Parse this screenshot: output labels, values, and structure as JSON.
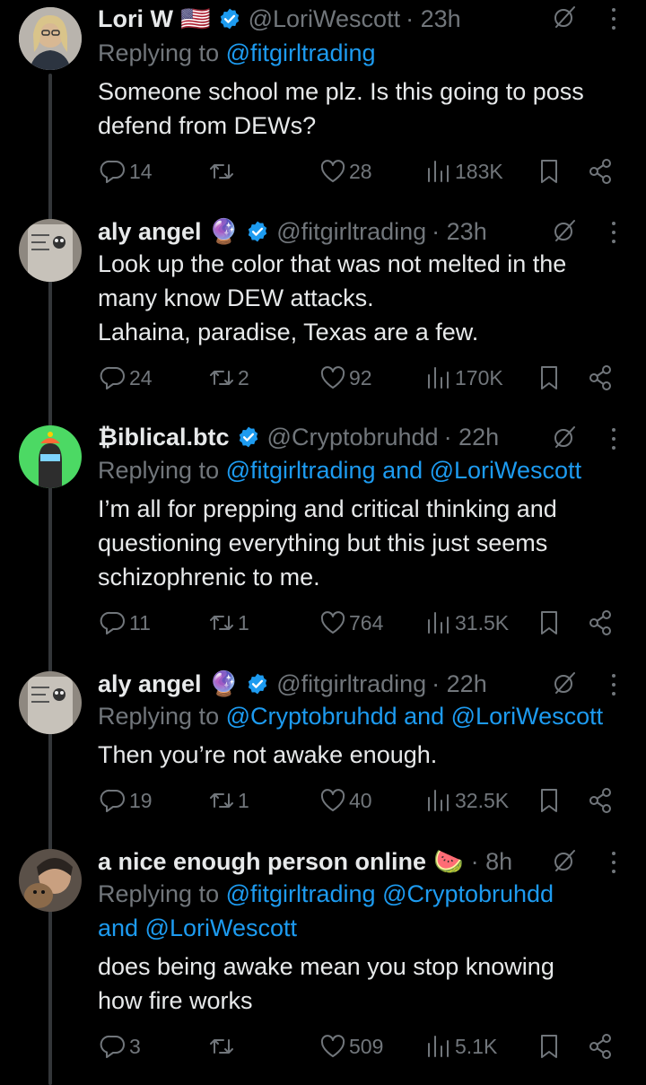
{
  "tweets": [
    {
      "name": "Lori W",
      "flag": "🇺🇸",
      "handle": "@LoriWescott",
      "time": "· 23h",
      "reply_prefix": "Replying to ",
      "reply_lines": [
        [
          "@fitgirltrading"
        ]
      ],
      "text_lines": [
        "Someone school me plz. Is this going to poss",
        "defend from DEWs?"
      ],
      "replies": "14",
      "retweets": "",
      "likes": "28",
      "views": "183K"
    },
    {
      "name": "aly angel",
      "emoji": "🔮",
      "handle": "@fitgirltrading",
      "time": "· 23h",
      "text_lines": [
        "Look up the color that was not melted in the",
        "many know DEW attacks.",
        "Lahaina, paradise, Texas are a few."
      ],
      "replies": "24",
      "retweets": "2",
      "likes": "92",
      "views": "170K"
    },
    {
      "name": "₿iblical.btc",
      "handle": "@Cryptobruhdd",
      "time": "· 22h",
      "reply_prefix": "Replying to ",
      "reply_line": "@fitgirltrading and @LoriWescott",
      "text_lines": [
        "I’m all for prepping and critical thinking and",
        "questioning everything but this just seems",
        "schizophrenic to me."
      ],
      "replies": "11",
      "retweets": "1",
      "likes": "764",
      "views": "31.5K"
    },
    {
      "name": "aly angel",
      "emoji": "🔮",
      "handle": "@fitgirltrading",
      "time": "· 22h",
      "reply_prefix": "Replying to ",
      "reply_line": "@Cryptobruhdd and @LoriWescott",
      "text_lines": [
        "Then you’re not awake enough."
      ],
      "replies": "19",
      "retweets": "1",
      "likes": "40",
      "views": "32.5K"
    },
    {
      "name": "a nice enough person online",
      "emoji": "🍉",
      "time": "· 8h",
      "reply_prefix": "Replying to ",
      "reply_line1": "@fitgirltrading @Cryptobruhdd",
      "reply_line2": "and @LoriWescott",
      "text_lines": [
        "does being awake mean you stop knowing",
        "how fire works"
      ],
      "replies": "3",
      "retweets": "",
      "likes": "509",
      "views": "5.1K"
    }
  ],
  "colors": {
    "accent": "#1d9bf0",
    "muted": "#71767b",
    "text": "#e7e9ea",
    "background": "#000000"
  },
  "icons": [
    "reply-icon",
    "retweet-icon",
    "like-icon",
    "views-icon",
    "bookmark-icon",
    "share-icon",
    "grok-icon",
    "more-icon",
    "verified-badge-icon"
  ]
}
